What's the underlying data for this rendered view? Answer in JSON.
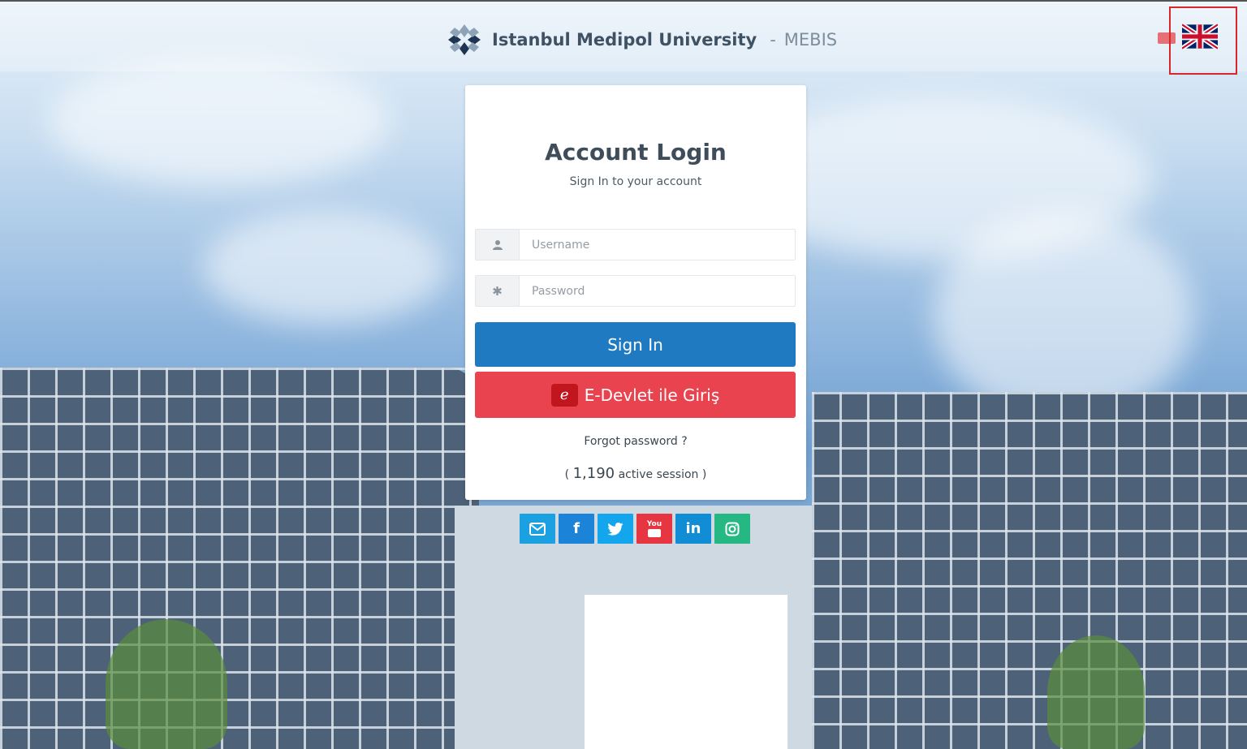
{
  "header": {
    "university_name": "Istanbul Medipol University",
    "separator": "-",
    "app_name": "MEBIS"
  },
  "language": {
    "selected": "English",
    "flag_icon": "uk-flag-icon",
    "highlight_color": "#d9262b"
  },
  "login": {
    "title": "Account Login",
    "subtitle": "Sign In to your account",
    "username_placeholder": "Username",
    "password_placeholder": "Password",
    "signin_label": "Sign In",
    "edevlet_label": "E-Devlet ile Giriş",
    "forgot_label": "Forgot password ?",
    "session_open": "(",
    "session_count": "1,190",
    "session_suffix": "active session )"
  },
  "social": [
    {
      "name": "email",
      "icon": "envelope-icon",
      "color": "#1ba1e2"
    },
    {
      "name": "facebook",
      "icon": "facebook-icon",
      "color": "#1c84d8"
    },
    {
      "name": "twitter",
      "icon": "twitter-icon",
      "color": "#13a6ec"
    },
    {
      "name": "youtube",
      "icon": "youtube-icon",
      "color": "#e53642"
    },
    {
      "name": "linkedin",
      "icon": "linkedin-icon",
      "color": "#118dd5"
    },
    {
      "name": "instagram",
      "icon": "instagram-icon",
      "color": "#25b883"
    }
  ],
  "colors": {
    "primary": "#1f7ac2",
    "danger": "#e8434f"
  }
}
